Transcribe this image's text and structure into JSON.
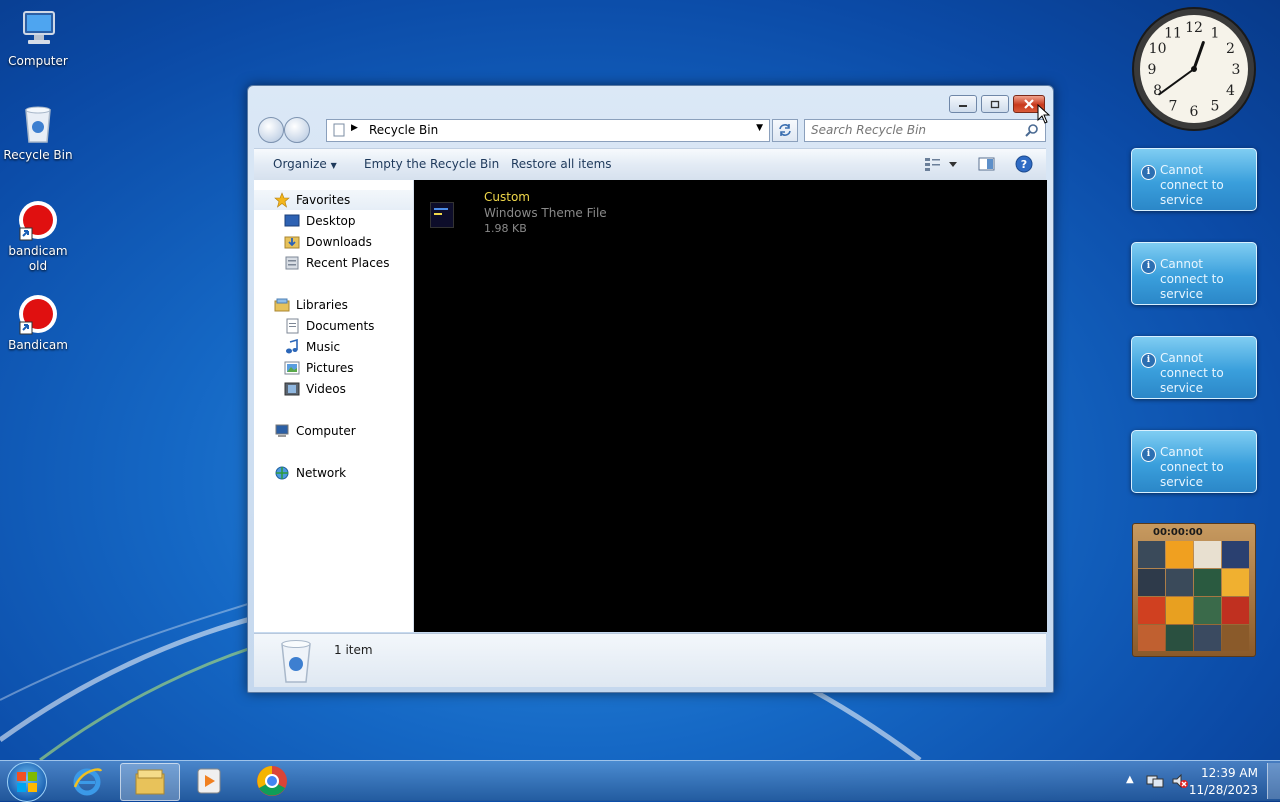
{
  "desktop": {
    "icons": [
      {
        "label": "Computer"
      },
      {
        "label": "Recycle Bin"
      },
      {
        "label": "bandicam old"
      },
      {
        "label": "Bandicam"
      }
    ]
  },
  "explorer": {
    "address": "Recycle Bin",
    "search_placeholder": "Search Recycle Bin",
    "toolbar": {
      "organize": "Organize",
      "empty": "Empty the Recycle Bin",
      "restore": "Restore all items"
    },
    "nav": {
      "favorites": "Favorites",
      "desktop": "Desktop",
      "downloads": "Downloads",
      "recent": "Recent Places",
      "libraries": "Libraries",
      "documents": "Documents",
      "music": "Music",
      "pictures": "Pictures",
      "videos": "Videos",
      "computer": "Computer",
      "network": "Network"
    },
    "file": {
      "name": "Custom",
      "type": "Windows Theme File",
      "size": "1.98 KB"
    },
    "status": "1 item"
  },
  "gadgets": {
    "message": "Cannot connect to service",
    "puzzle_timer": "00:00:00",
    "clock": {
      "hour": 12,
      "minute": 39
    }
  },
  "taskbar": {
    "time": "12:39 AM",
    "date": "11/28/2023"
  },
  "colors": {
    "accent": "#1568c5",
    "file_name": "#f0d84a",
    "file_meta": "#8a8a8a"
  }
}
